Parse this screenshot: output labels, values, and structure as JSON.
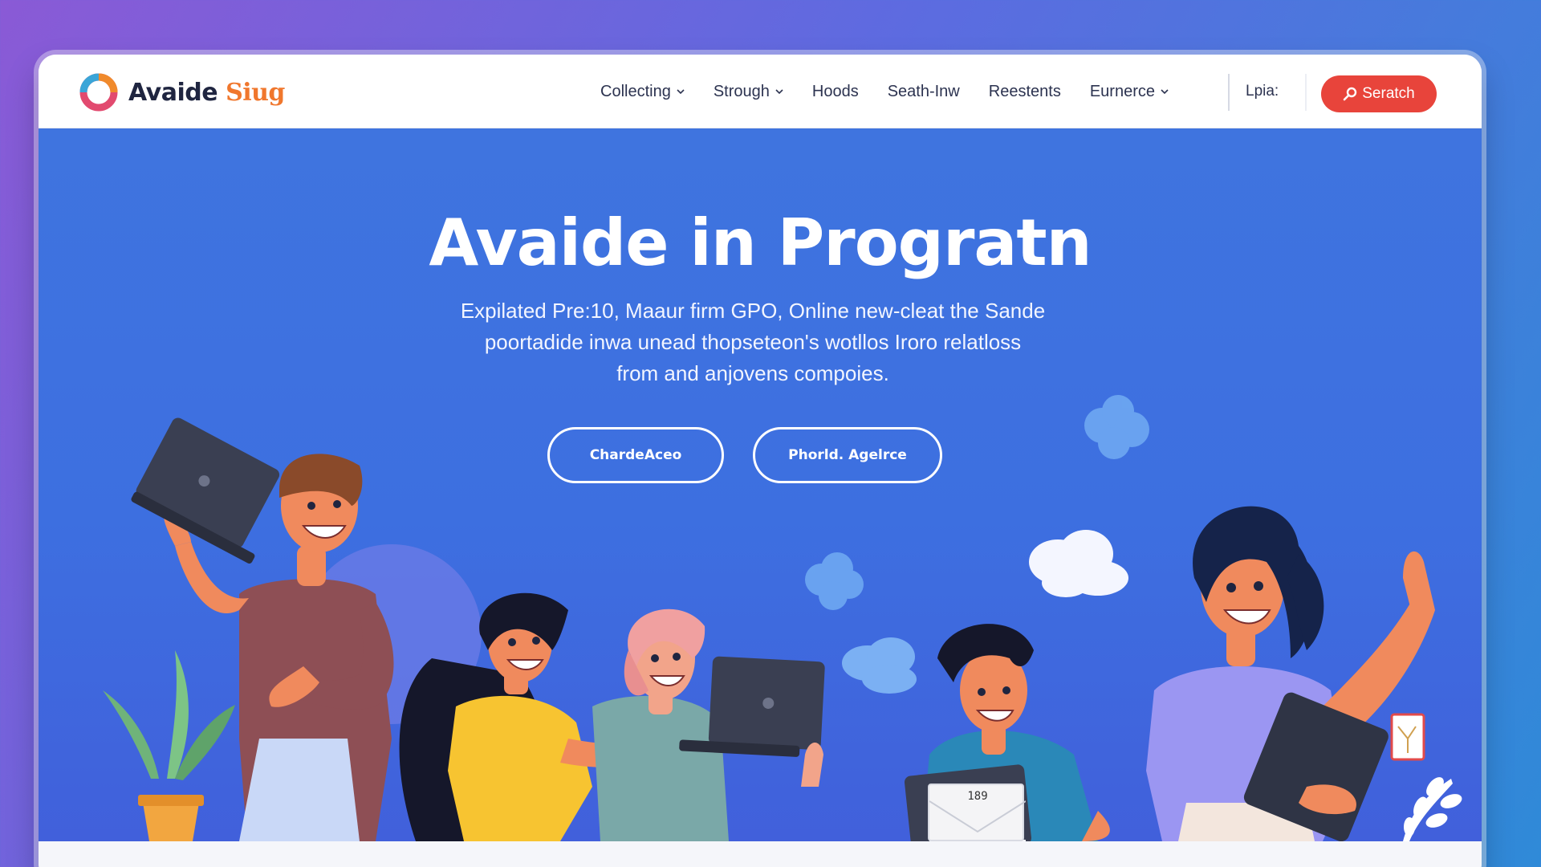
{
  "brand": {
    "name": "Avaide",
    "accent": "Siug",
    "logo_icon": "ring-logo-icon"
  },
  "nav": {
    "items": [
      {
        "label": "Collecting",
        "has_dropdown": true
      },
      {
        "label": "Strough",
        "has_dropdown": true
      },
      {
        "label": "Hoods",
        "has_dropdown": false
      },
      {
        "label": "Seath-Inw",
        "has_dropdown": false
      },
      {
        "label": "Reestents",
        "has_dropdown": false
      },
      {
        "label": "Eurnerce",
        "has_dropdown": true
      }
    ],
    "extra_label": "Lpia:",
    "search_label": "Seratch",
    "search_icon": "search-icon"
  },
  "hero": {
    "title": "Avaide in Progratn",
    "subtitle_lines": [
      "Expilated Pre:10, Maaur firm GPO, Online new-cleat the Sande",
      "poortadide inwa unead thopseteon's wotllos Iroro relatloss",
      "from and anjovens compoies."
    ],
    "buttons": [
      {
        "label": "ChardeAceo"
      },
      {
        "label": "Phorld. Agelrce"
      }
    ],
    "envelope_number": "189"
  },
  "colors": {
    "hero_bg": "#3f74df",
    "accent_orange": "#f0772d",
    "search_red": "#e8443b",
    "text_dark": "#2c3350"
  }
}
